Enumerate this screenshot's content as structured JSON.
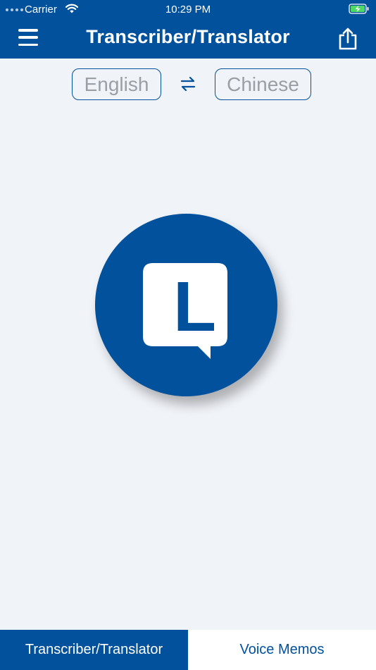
{
  "status_bar": {
    "carrier": "Carrier",
    "time": "10:29 PM"
  },
  "nav": {
    "title": "Transcriber/Translator",
    "menu_icon": "hamburger-menu-icon",
    "share_icon": "share-icon"
  },
  "languages": {
    "source": "English",
    "target": "Chinese",
    "swap_icon": "swap-arrows-icon"
  },
  "record_button": {
    "logo_letter": "L",
    "icon": "speech-bubble-logo-icon"
  },
  "tabs": [
    {
      "label": "Transcriber/Translator",
      "active": true
    },
    {
      "label": "Voice Memos",
      "active": false
    }
  ],
  "colors": {
    "primary": "#02519d",
    "background": "#f0f3f8",
    "placeholder_text": "#9a9fa6",
    "battery": "#4cd964"
  }
}
